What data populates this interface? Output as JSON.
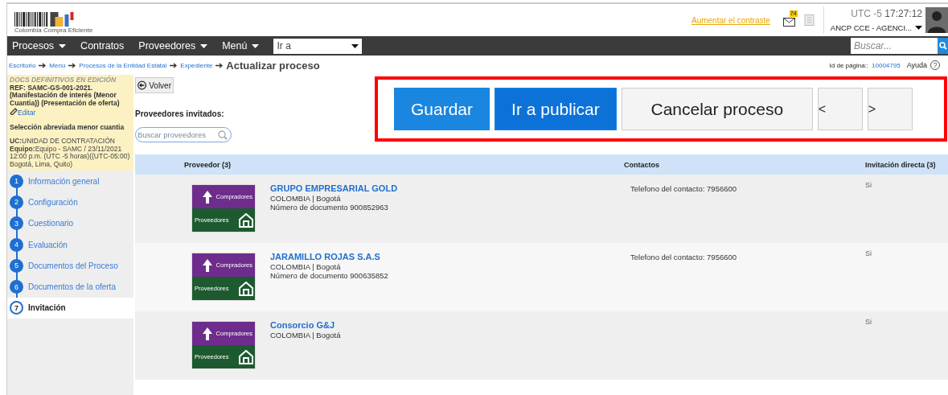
{
  "header": {
    "logo_text": "Colombia Compra Eficiente",
    "contrast_link": "Aumentar el contraste",
    "mail_badge": "74",
    "time_zone": "UTC -5",
    "clock": "17:27:12",
    "account": "ANCP CCE - AGENCI..."
  },
  "nav": {
    "items": [
      {
        "label": "Procesos",
        "dropdown": true
      },
      {
        "label": "Contratos",
        "dropdown": false
      },
      {
        "label": "Proveedores",
        "dropdown": true
      },
      {
        "label": "Menú",
        "dropdown": true
      }
    ],
    "goto": {
      "value": "Ir a"
    },
    "search": {
      "placeholder": "Buscar..."
    }
  },
  "breadcrumb": {
    "links": [
      "Escritorio",
      "Menú",
      "Procesos de la Entidad Estatal",
      "Expediente"
    ],
    "current": "Actualizar proceso"
  },
  "page_id": {
    "label": "Id de página::",
    "value": "10004795",
    "help": "Ayuda",
    "help_icon": "?"
  },
  "process": {
    "status": "DOCS DEFINITIVOS EN EDICIÓN",
    "ref": "REF: SAMC-GS-001-2021. (Manifestación de interés (Menor Cuantia)) (Presentación de oferta)",
    "edit": "Editar",
    "type": "Selección abreviada menor cuantia",
    "unit": "**UC:**UNIDAD DE CONTRATACIÓN **Equipo:**Equipo - SAMC / 23/11/2021 12:00 p.m. (UTC -5 horas)((UTC-05:00) Bogotá, Lima, Quito)"
  },
  "steps": [
    {
      "number": "1",
      "label": "Información general",
      "selected": false
    },
    {
      "number": "2",
      "label": "Configuración",
      "selected": false
    },
    {
      "number": "3",
      "label": "Cuestionario",
      "selected": false
    },
    {
      "number": "4",
      "label": "Evaluación",
      "selected": false
    },
    {
      "number": "5",
      "label": "Documentos del Proceso",
      "selected": false
    },
    {
      "number": "6",
      "label": "Documentos de la oferta",
      "selected": false
    },
    {
      "number": "7",
      "label": "Invitación",
      "selected": true
    }
  ],
  "back_button": "Volver",
  "actions": [
    {
      "label": "Guardar",
      "kind": "primary"
    },
    {
      "label": "Ir a publicar",
      "kind": "primary"
    },
    {
      "label": "Cancelar proceso",
      "kind": "secondary"
    },
    {
      "label": "<",
      "kind": "nav"
    },
    {
      "label": ">",
      "kind": "nav"
    }
  ],
  "section_title": "Proveedores invitados:",
  "supplier_search": {
    "placeholder": "Buscar proveedores"
  },
  "table": {
    "columns": [
      "Proveedor (3)",
      "Contactos",
      "Invitación directa (3)"
    ],
    "rows": [
      {
        "logo_top": "Compradores",
        "logo_bottom": "Proveedores",
        "name": "GRUPO EMPRESARIAL GOLD",
        "location": "COLOMBIA | Bogotá",
        "document": "Número de documento 900852963",
        "contact": "Telefono del contacto: 7956600",
        "direct": "Si"
      },
      {
        "logo_top": "Compradores",
        "logo_bottom": "Proveedores",
        "name": "JARAMILLO ROJAS S.A.S",
        "location": "COLOMBIA | Bogotá",
        "document": "Número de documento 900635852",
        "contact": "Telefono del contacto: 7956600",
        "direct": "Si"
      },
      {
        "logo_top": "Compradores",
        "logo_bottom": "Proveedores",
        "name": "Consorcio G&J",
        "location": "COLOMBIA | Bogotá",
        "direct": "Si"
      }
    ]
  }
}
